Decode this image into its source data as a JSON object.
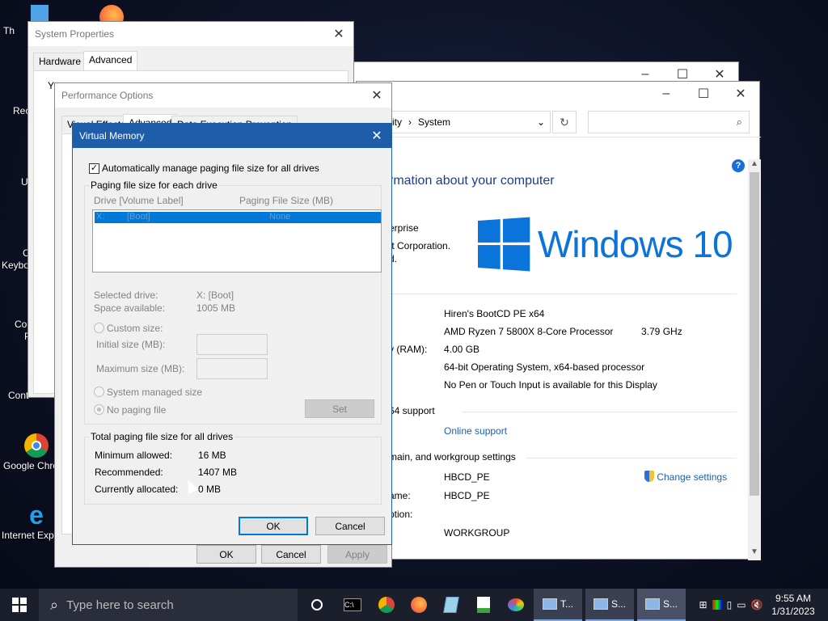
{
  "desktop_icons": [
    {
      "label": "Th",
      "icon": "this-pc-icon"
    },
    {
      "label": "Rec",
      "icon": "recycle-bin-icon"
    },
    {
      "label": "U",
      "icon": "user-icon"
    },
    {
      "label": "C\nKeybo",
      "icon": "keyboard-icon"
    },
    {
      "label": "Co\nP",
      "icon": "control-panel-icon"
    },
    {
      "label": "Cont",
      "icon": "control-icon"
    },
    {
      "label": "Google Chro",
      "icon": "chrome-icon"
    },
    {
      "label": "Internet Expl",
      "icon": "internet-explorer-icon"
    }
  ],
  "system_window": {
    "breadcrumb": [
      "rity",
      "System"
    ],
    "heading": "rmation about your computer",
    "edition_lines": [
      "erprise",
      "ft Corporation.",
      "d."
    ],
    "logo_text": "Windows 10",
    "rows": [
      {
        "label": "",
        "value": "Hiren's BootCD PE x64"
      },
      {
        "label": "",
        "value": "AMD Ryzen 7 5800X 8-Core Processor",
        "extra": "3.79 GHz"
      },
      {
        "label": "y (RAM):",
        "value": "4.00 GB"
      },
      {
        "label": "",
        "value": "64-bit Operating System, x64-based processor"
      },
      {
        "label": "",
        "value": "No Pen or Touch Input is available for this Display"
      }
    ],
    "support_heading": "64 support",
    "online_support": "Online support",
    "domain_heading": "main, and workgroup settings",
    "domain_rows": [
      {
        "label": ":",
        "value": "HBCD_PE"
      },
      {
        "label": "ame:",
        "value": "HBCD_PE"
      },
      {
        "label": "ption:",
        "value": ""
      },
      {
        "label": "",
        "value": "WORKGROUP"
      }
    ],
    "change_settings": "Change settings"
  },
  "system_properties": {
    "title": "System Properties",
    "tabs": [
      "Hardware",
      "Advanced"
    ],
    "fragment_y": "Y"
  },
  "performance_options": {
    "title": "Performance Options",
    "tabs": [
      "Visual Effects",
      "Advanced",
      "Data Execution Prevention"
    ],
    "ok": "OK",
    "cancel": "Cancel",
    "apply": "Apply"
  },
  "virtual_memory": {
    "title": "Virtual Memory",
    "auto_manage_label": "Automatically manage paging file size for all drives",
    "auto_manage_checked": true,
    "group_label": "Paging file size for each drive",
    "col_drive": "Drive  [Volume Label]",
    "col_size": "Paging File Size (MB)",
    "list_items": [
      {
        "drive": "X:",
        "label": "[Boot]",
        "size": "None"
      }
    ],
    "selected_drive_label": "Selected drive:",
    "selected_drive_value": "X:  [Boot]",
    "space_available_label": "Space available:",
    "space_available_value": "1005 MB",
    "custom_size": "Custom size:",
    "initial_size": "Initial size (MB):",
    "maximum_size": "Maximum size (MB):",
    "system_managed": "System managed size",
    "no_paging": "No paging file",
    "set": "Set",
    "total_label": "Total paging file size for all drives",
    "min_allowed_label": "Minimum allowed:",
    "min_allowed_value": "16 MB",
    "recommended_label": "Recommended:",
    "recommended_value": "1407 MB",
    "allocated_label": "Currently allocated:",
    "allocated_value": "0 MB",
    "ok": "OK",
    "cancel": "Cancel"
  },
  "taskbar": {
    "search_placeholder": "Type here to search",
    "apps": [
      "T...",
      "S...",
      "S..."
    ],
    "time": "9:55 AM",
    "date": "1/31/2023"
  },
  "colors": {
    "accent": "#0078d7",
    "title_active": "#1e5ea9",
    "selection": "#0078d7",
    "windows_blue": "#0a74da"
  }
}
